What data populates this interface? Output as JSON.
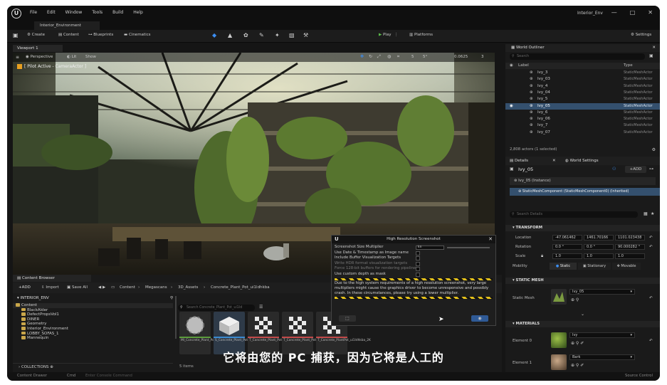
{
  "menubar": {
    "items": [
      "File",
      "Edit",
      "Window",
      "Tools",
      "Build",
      "Help"
    ],
    "project": "Interior_Env",
    "controls": [
      "—",
      "□",
      "✕"
    ]
  },
  "level_tab": "Interior_Environment",
  "toolbar": {
    "save_icon": "save-icon",
    "create": "Create",
    "content": "Content",
    "blueprints": "Blueprints",
    "cinematics": "Cinematics",
    "play": "Play",
    "platforms": "Platforms",
    "settings": "Settings"
  },
  "viewport": {
    "tab": "Viewport 1",
    "perspective": "Perspective",
    "lit": "Lit",
    "show": "Show",
    "pilot": "[ Pilot Active - CameraActor ]",
    "snap_grid": "5",
    "snap_angle": "5°",
    "scale": "0.0625",
    "cam_speed": "3"
  },
  "screenshot_dialog": {
    "title": "High Resolution Screenshot",
    "rows": [
      {
        "label": "Screenshot Size Multiplier",
        "value": "kn"
      },
      {
        "label": "Use Date & Timestamp as Image name"
      },
      {
        "label": "Include Buffer Visualization Targets"
      },
      {
        "label": "Write HDR format visualization targets",
        "dim": true
      },
      {
        "label": "Force 128-bit buffers for rendering pipeline",
        "dim": true
      },
      {
        "label": "Use custom depth as mask"
      }
    ],
    "warning": "Due to the high system requirements of a high resolution screenshot, very large multipliers might cause the graphics driver to become unresponsive and possibly crash. In these circumstances, please try using a lower multiplier."
  },
  "content_browser": {
    "tab": "Content Browser",
    "add": "ADD",
    "import": "Import",
    "save_all": "Save All",
    "path": [
      "Content",
      "Megascans",
      "3D_Assets",
      "Concrete_Plant_Pot_ui1ldhkba"
    ],
    "root": "INTERIOR_ENV",
    "tree": [
      "Content",
      "BlackAlder",
      "DefectPropsVol1",
      "DINER",
      "Geometry",
      "Interior_Environment",
      "LOBBY_SOFAS_1",
      "Mannequin"
    ],
    "search_placeholder": "Search Concrete_Plant_Pot_ui1ld",
    "items_count": "5 items",
    "collections": "COLLECTIONS",
    "assets": [
      {
        "name": "MI_Concrete_Plant_Pot_ui1ldhkba_2K",
        "kind": "material"
      },
      {
        "name": "S_Concrete_Plant_Pot_ui1ldhkba_lod3",
        "kind": "mesh"
      },
      {
        "name": "T_Concrete_Plant_Pot_ui1ldhkba_2K",
        "kind": "texture"
      },
      {
        "name": "T_Concrete_Plant_Pot_ui1ldhkba_2K",
        "kind": "texture"
      },
      {
        "name": "T_Concrete_PlantPot_ui1ldhkba_2K",
        "kind": "texture"
      }
    ]
  },
  "subtitle": "它将由您的 PC 捕获，因为它将是人工的",
  "outliner": {
    "tab": "World Outliner",
    "search_placeholder": "Search",
    "col_label": "Label",
    "col_type": "Type",
    "rows": [
      {
        "name": "Ivy_3",
        "type": "StaticMeshActor"
      },
      {
        "name": "Ivy_03",
        "type": "StaticMeshActor"
      },
      {
        "name": "Ivy_4",
        "type": "StaticMeshActor"
      },
      {
        "name": "Ivy_04",
        "type": "StaticMeshActor"
      },
      {
        "name": "Ivy_5",
        "type": "StaticMeshActor"
      },
      {
        "name": "Ivy_05",
        "type": "StaticMeshActor",
        "selected": true
      },
      {
        "name": "Ivy_6",
        "type": "StaticMeshActor"
      },
      {
        "name": "Ivy_06",
        "type": "StaticMeshActor"
      },
      {
        "name": "Ivy_7",
        "type": "StaticMeshActor"
      },
      {
        "name": "Ivy_07",
        "type": "StaticMeshActor"
      }
    ],
    "count": "2,808 actors (1 selected)"
  },
  "details": {
    "tab": "Details",
    "world_settings": "World Settings",
    "actor": "Ivy_05",
    "add": "ADD",
    "instance": "Ivy_05 (Instance)",
    "component": "StaticMeshComponent (StaticMeshComponent0) (Inherited)",
    "search_placeholder": "Search Details",
    "transform": "TRANSFORM",
    "location_label": "Location",
    "location": [
      "-47.061462",
      "1461.70166",
      "1101.023438"
    ],
    "rotation_label": "Rotation",
    "rotation": [
      "0.0 °",
      "0.0 °",
      "90.000282 °"
    ],
    "scale_label": "Scale",
    "scale": [
      "1.0",
      "1.0",
      "1.0"
    ],
    "mobility_label": "Mobility",
    "mobility": [
      "Static",
      "Stationary",
      "Movable"
    ],
    "static_mesh_section": "STATIC MESH",
    "static_mesh_label": "Static Mesh",
    "static_mesh_value": "Ivy_05",
    "materials_section": "MATERIALS",
    "element0_label": "Element 0",
    "element0_value": "Ivy",
    "element1_label": "Element 1",
    "element1_value": "Bark"
  },
  "bottom": {
    "cb_tab": "Content Drawer",
    "output": "Cmd",
    "cmd_placeholder": "Enter Console Command",
    "source": "Source Control"
  }
}
